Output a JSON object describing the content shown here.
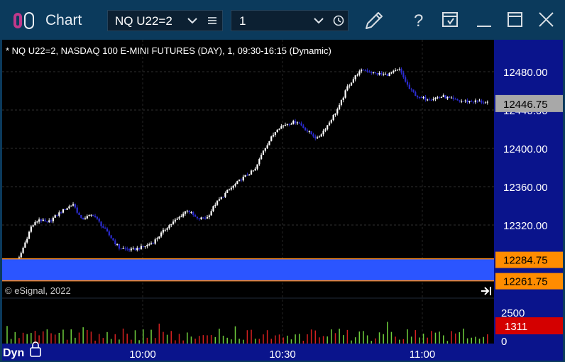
{
  "window": {
    "title": "Chart",
    "symbol_value": "NQ U22=2",
    "interval_value": "1"
  },
  "chart": {
    "info_line": "* NQ U22=2, NASDAQ 100 E-MINI FUTURES (DAY), 1, 09:30-16:15 (Dynamic)",
    "copyright": "© eSignal, 2022",
    "dyn_label": "Dyn",
    "price_ticks": [
      "12480.00",
      "12440.00",
      "12400.00",
      "12360.00",
      "12320.00"
    ],
    "last_price": "12446.75",
    "zone_top_price": "12284.75",
    "zone_bottom_price": "12261.75",
    "volume_tick": "2500",
    "volume_zero": "0",
    "last_volume": "1311",
    "time_ticks": [
      "10:00",
      "10:30",
      "11:00"
    ]
  },
  "colors": {
    "title_bg": "#0b3a5c",
    "axis_bg": "#0a148c",
    "up_candle": "#ffffff",
    "down_candle": "#2c2cd2",
    "zone_fill": "#2b55ff",
    "zone_border": "#ff8c1a",
    "price_label_last": "#a8a8a8",
    "zone_label_bg": "#ff8c00",
    "volume_up": "#6fcf3c",
    "volume_down": "#d42020",
    "last_volume_bg": "#d40000"
  },
  "icons": [
    "logo-icon",
    "chevron-down-icon",
    "list-icon",
    "clock-icon",
    "pencil-icon",
    "help-icon",
    "template-icon",
    "minimize-icon",
    "maximize-icon",
    "close-icon",
    "scroll-to-end-icon",
    "lock-icon"
  ]
}
